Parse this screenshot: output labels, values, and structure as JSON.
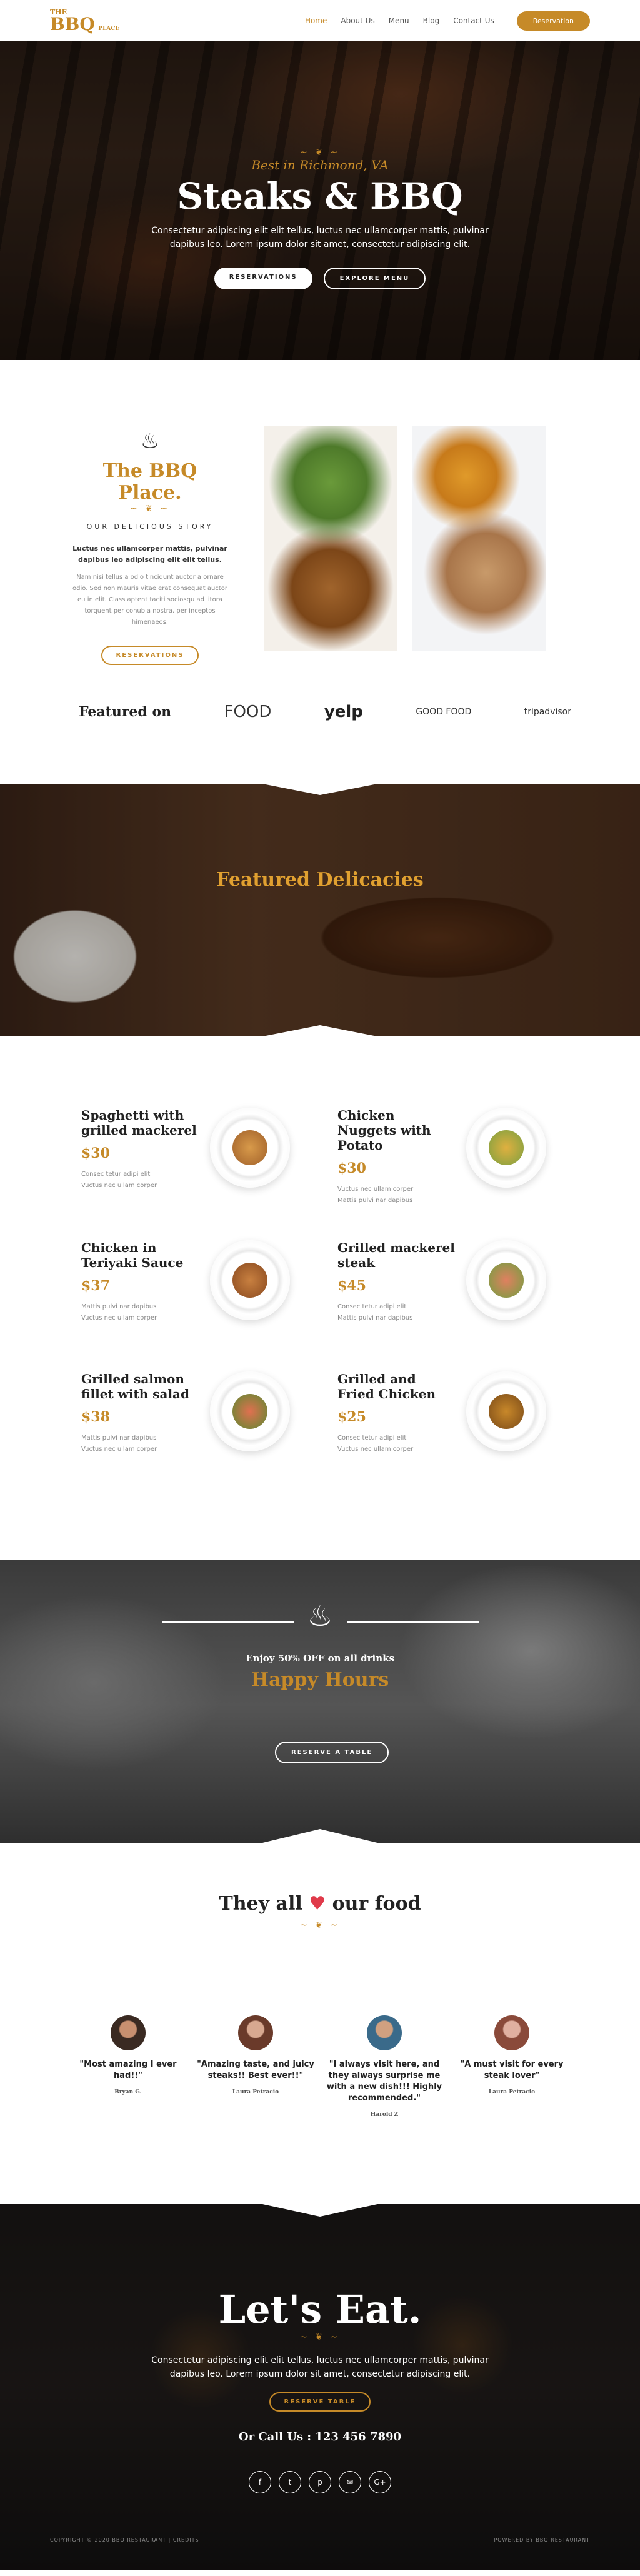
{
  "logo": {
    "top": "THE",
    "main": "BBQ",
    "sub": "PLACE"
  },
  "nav": {
    "items": [
      "Home",
      "About Us",
      "Menu",
      "Blog",
      "Contact Us"
    ],
    "active": "Home",
    "cta": "Reservation"
  },
  "hero": {
    "subtitle": "Best in Richmond, VA",
    "title": "Steaks & BBQ",
    "text": "Consectetur adipiscing elit elit tellus, luctus nec ullamcorper mattis, pulvinar dapibus leo. Lorem ipsum dolor sit amet, consectetur adipiscing elit.",
    "btn1": "RESERVATIONS",
    "btn2": "EXPLORE MENU"
  },
  "about": {
    "title": "The BBQ Place.",
    "story": "OUR DELICIOUS STORY",
    "bold": "Luctus nec ullamcorper mattis, pulvinar dapibus leo adipiscing elit elit tellus.",
    "text": "Nam nisi tellus a odio tincidunt auctor a ornare odio. Sed non mauris vitae erat consequat auctor eu in elit. Class aptent taciti sociosqu ad litora torquent per conubia nostra, per inceptos himenaeos.",
    "btn": "RESERVATIONS"
  },
  "featured": {
    "label": "Featured on",
    "logos": [
      "FOOD",
      "yelp",
      "GOOD FOOD",
      "tripadvisor"
    ]
  },
  "delicacies": {
    "title": "Featured Delicacies"
  },
  "menu": [
    {
      "name": "Spaghetti with grilled mackerel",
      "price": "$30",
      "d1": "Consec tetur adipi elit",
      "d2": "Vuctus nec ullam corper"
    },
    {
      "name": "Chicken Nuggets with Potato",
      "price": "$30",
      "d1": "Vuctus nec ullam corper",
      "d2": "Mattis pulvi nar dapibus"
    },
    {
      "name": "Chicken in Teriyaki Sauce",
      "price": "$37",
      "d1": "Mattis pulvi nar dapibus",
      "d2": "Vuctus nec ullam corper"
    },
    {
      "name": "Grilled mackerel steak",
      "price": "$45",
      "d1": "Consec tetur adipi elit",
      "d2": "Mattis pulvi nar dapibus"
    },
    {
      "name": "Grilled salmon fillet with salad",
      "price": "$38",
      "d1": "Mattis pulvi nar dapibus",
      "d2": "Vuctus nec ullam corper"
    },
    {
      "name": "Grilled and Fried Chicken",
      "price": "$25",
      "d1": "Consec tetur adipi elit",
      "d2": "Vuctus nec ullam corper"
    }
  ],
  "happy": {
    "line1": "Enjoy 50% OFF on all drinks",
    "title": "Happy Hours",
    "btn": "RESERVE A TABLE"
  },
  "testimonials": {
    "title_a": "They all",
    "title_b": "our food",
    "items": [
      {
        "quote": "\"Most amazing I ever had!!\"",
        "name": "Bryan G."
      },
      {
        "quote": "\"Amazing taste, and juicy steaks!! Best ever!!\"",
        "name": "Laura Petracio"
      },
      {
        "quote": "\"I always visit here, and they always surprise me with a new dish!!! Highly recommended.\"",
        "name": "Harold Z"
      },
      {
        "quote": "\"A must visit for every steak lover\"",
        "name": "Laura Petracio"
      }
    ]
  },
  "footer": {
    "title": "Let's Eat.",
    "text": "Consectetur adipiscing elit elit tellus, luctus nec ullamcorper mattis, pulvinar dapibus leo. Lorem ipsum dolor sit amet, consectetur adipiscing elit.",
    "btn": "RESERVE TABLE",
    "call": "Or Call Us : 123 456 7890",
    "socials": [
      "f",
      "t",
      "p",
      "✉",
      "G+"
    ],
    "copy_left": "COPYRIGHT © 2020 BBQ RESTAURANT | CREDITS",
    "copy_right": "POWERED BY BBQ RESTAURANT"
  },
  "colors": {
    "accent": "#c68a28",
    "heart": "#e03a4a"
  }
}
